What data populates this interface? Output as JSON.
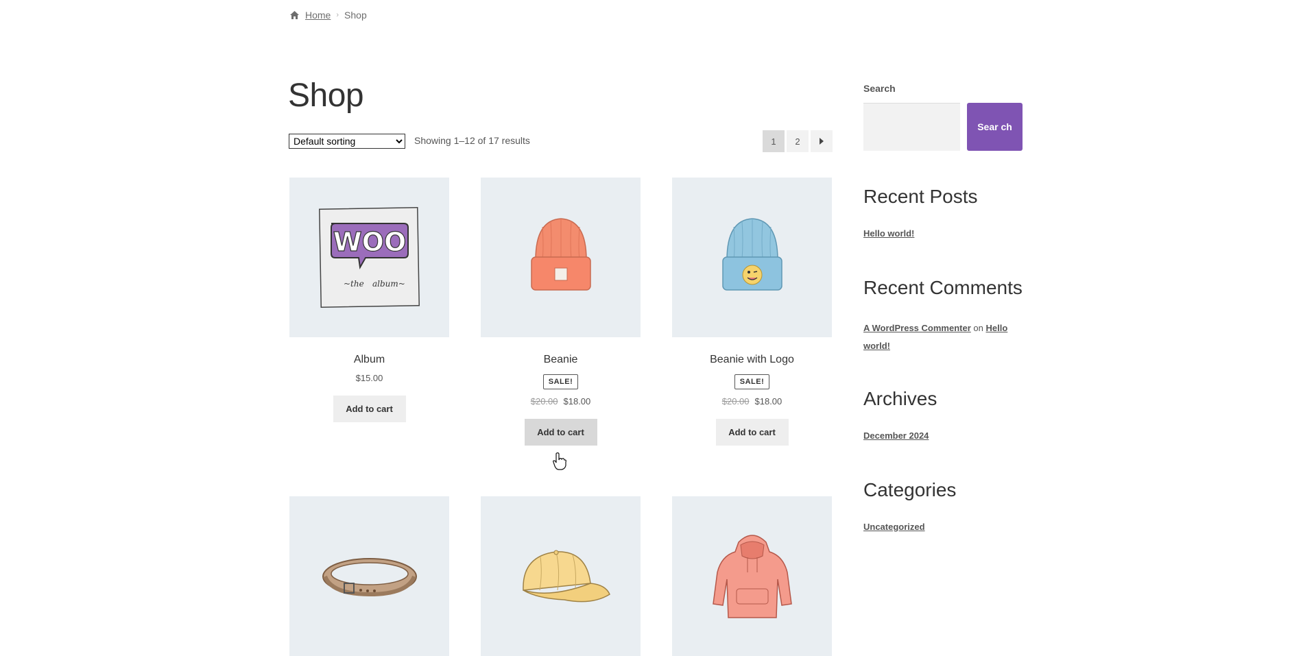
{
  "breadcrumb": {
    "home": "Home",
    "current": "Shop"
  },
  "page_title": "Shop",
  "sorting": {
    "selected": "Default sorting"
  },
  "result_count": "Showing 1–12 of 17 results",
  "pagination": {
    "pages": [
      "1",
      "2"
    ],
    "current": "1",
    "next_icon": "arrow-right-icon"
  },
  "products": [
    {
      "name": "Album",
      "price": "$15.00",
      "button": "Add to cart",
      "image": "woo-album"
    },
    {
      "name": "Beanie",
      "sale_badge": "SALE!",
      "old_price": "$20.00",
      "price": "$18.00",
      "button": "Add to cart",
      "image": "orange-beanie"
    },
    {
      "name": "Beanie with Logo",
      "sale_badge": "SALE!",
      "old_price": "$20.00",
      "price": "$18.00",
      "button": "Add to cart",
      "image": "blue-beanie"
    },
    {
      "image": "belt"
    },
    {
      "image": "cap"
    },
    {
      "image": "hoodie"
    }
  ],
  "sidebar": {
    "search_label": "Search",
    "search_button": "Sear ch",
    "recent_posts_title": "Recent Posts",
    "recent_posts": [
      "Hello world!"
    ],
    "recent_comments_title": "Recent Comments",
    "recent_comment": {
      "author": "A WordPress Commenter",
      "on": "on",
      "post_line1": "Hello",
      "post_line2": "world!"
    },
    "archives_title": "Archives",
    "archives": [
      "December 2024"
    ],
    "categories_title": "Categories",
    "categories": [
      "Uncategorized"
    ]
  },
  "colors": {
    "accent": "#7f54b3",
    "thumb_bg": "#e9eef2",
    "button_bg": "#eeeeee"
  }
}
